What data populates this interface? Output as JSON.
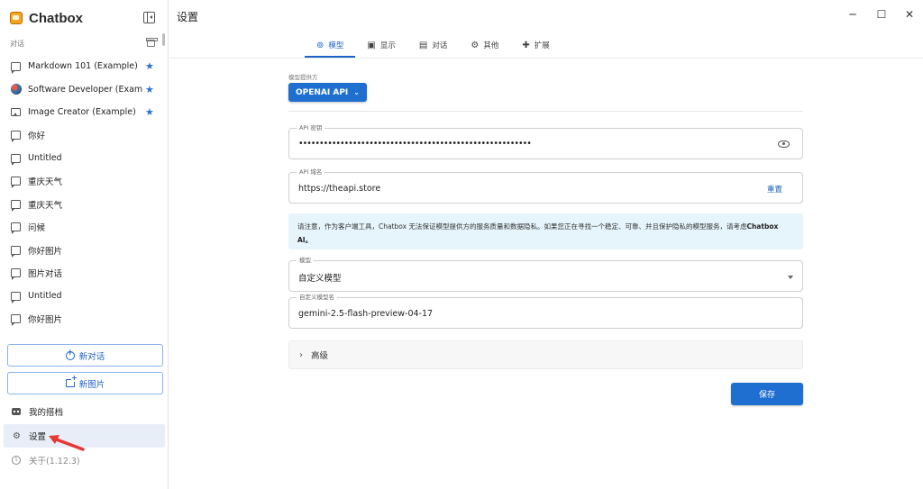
{
  "app": {
    "name": "Chatbox"
  },
  "sidebar": {
    "section_label": "对话",
    "conversations": [
      {
        "label": "Markdown 101 (Example)",
        "icon": "chat-icon",
        "starred": true
      },
      {
        "label": "Software Developer (Example)",
        "icon": "avatar-icon",
        "starred": true
      },
      {
        "label": "Image Creator (Example)",
        "icon": "image-icon",
        "starred": true
      },
      {
        "label": "你好",
        "icon": "chat-icon",
        "starred": false
      },
      {
        "label": "Untitled",
        "icon": "chat-icon",
        "starred": false
      },
      {
        "label": "重庆天气",
        "icon": "chat-icon",
        "starred": false
      },
      {
        "label": "重庆天气",
        "icon": "chat-icon",
        "starred": false
      },
      {
        "label": "问候",
        "icon": "chat-icon",
        "starred": false
      },
      {
        "label": "你好图片",
        "icon": "chat-icon",
        "starred": false
      },
      {
        "label": "图片对话",
        "icon": "chat-icon",
        "starred": false
      },
      {
        "label": "Untitled",
        "icon": "chat-icon",
        "starred": false
      },
      {
        "label": "你好图片",
        "icon": "chat-icon",
        "starred": false
      }
    ],
    "new_chat_label": "新对话",
    "new_image_label": "新图片",
    "copilots_label": "我的搭档",
    "settings_label": "设置",
    "about_label": "关于(1.12.3)"
  },
  "main": {
    "title": "设置",
    "tabs": [
      {
        "label": "模型",
        "icon": "model-icon",
        "active": true
      },
      {
        "label": "显示",
        "icon": "display-icon",
        "active": false
      },
      {
        "label": "对话",
        "icon": "chat-icon",
        "active": false
      },
      {
        "label": "其他",
        "icon": "gear-icon",
        "active": false
      },
      {
        "label": "扩展",
        "icon": "puzzle-icon",
        "active": false
      }
    ],
    "provider": {
      "label": "模型提供方",
      "value": "OPENAI API"
    },
    "api_key": {
      "label": "API 密钥",
      "value": "••••••••••••••••••••••••••••••••••••••••••••••••••••••••"
    },
    "api_host": {
      "label": "API 域名",
      "value": "https://theapi.store",
      "reset_label": "重置"
    },
    "notice": {
      "text": "请注意，作为客户端工具，Chatbox 无法保证模型提供方的服务质量和数据隐私。如果您正在寻找一个稳定、可靠、并且保护隐私的模型服务，请考虑",
      "highlight": "Chatbox AI。"
    },
    "model": {
      "label": "模型",
      "value": "自定义模型"
    },
    "custom_model": {
      "label": "自定义模型名",
      "value": "gemini-2.5-flash-preview-04-17"
    },
    "advanced_label": "高级",
    "save_label": "保存"
  },
  "colors": {
    "accent": "#1e6fd0",
    "notice_bg": "#e6f4fb",
    "star": "#2b72d6",
    "arrow": "#e53935"
  }
}
